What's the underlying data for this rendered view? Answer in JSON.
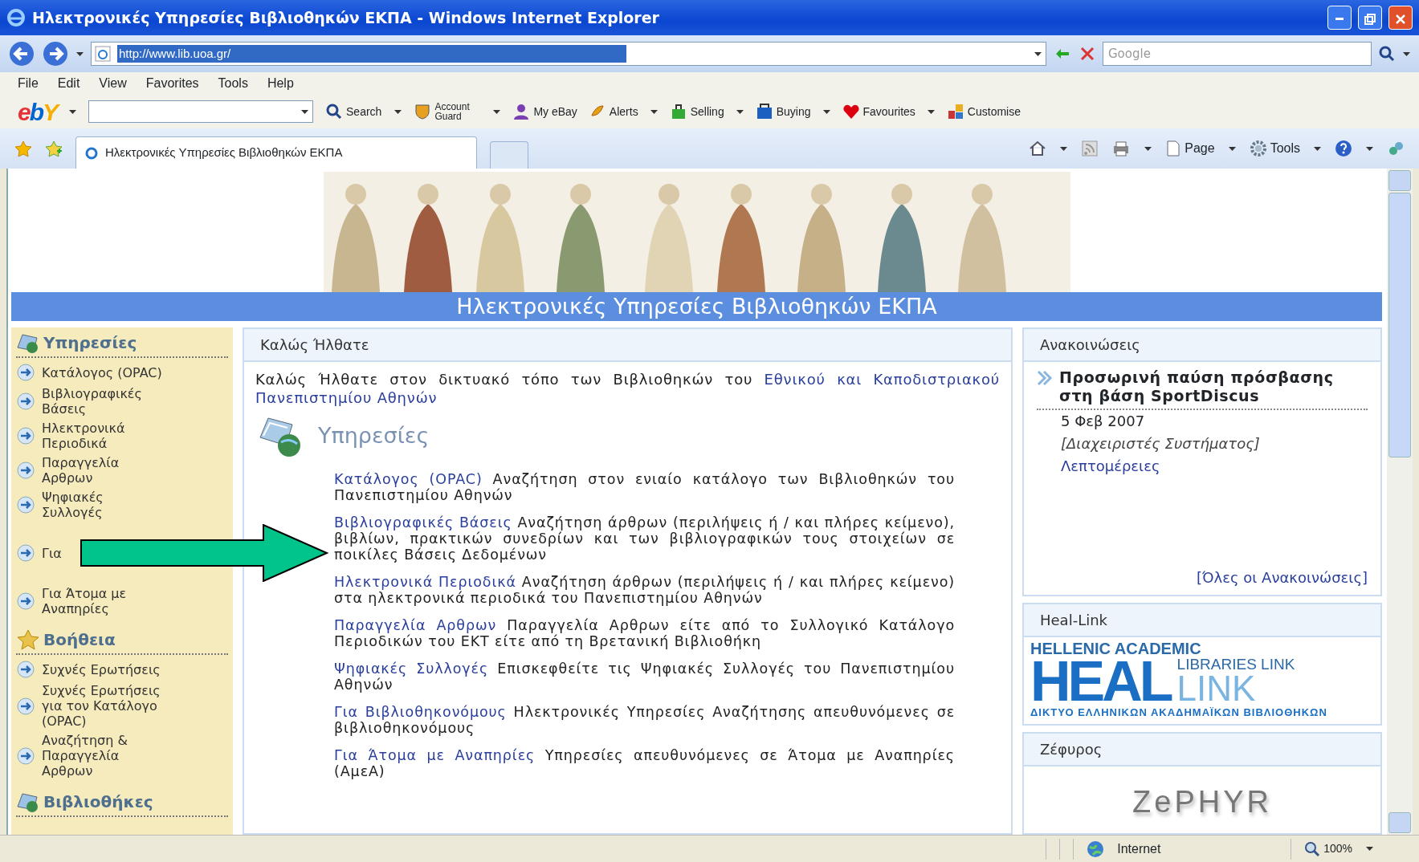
{
  "window": {
    "title": "Ηλεκτρονικές Υπηρεσίες Βιβλιοθηκών ΕΚΠΑ - Windows Internet Explorer"
  },
  "address_bar": {
    "url": "http://www.lib.uoa.gr/",
    "search_placeholder": "Google"
  },
  "menu": [
    "File",
    "Edit",
    "View",
    "Favorites",
    "Tools",
    "Help"
  ],
  "ebay_toolbar": {
    "logo": "ebY",
    "search_label": "Search",
    "items": [
      "Account Guard",
      "My eBay",
      "Alerts",
      "Selling",
      "Buying",
      "Favourites",
      "Customise"
    ]
  },
  "tab": {
    "title": "Ηλεκτρονικές Υπηρεσίες Βιβλιοθηκών ΕΚΠΑ",
    "selected": true
  },
  "command_bar": [
    "Page",
    "Tools"
  ],
  "page": {
    "banner_title": "Ηλεκτρονικές Υπηρεσίες Βιβλιοθηκών ΕΚΠΑ",
    "sidebar": [
      {
        "title": "Υπηρεσίες",
        "kind": "folder",
        "items": [
          "Κατάλογος (OPAC)",
          "Βιβλιογραφικές Βάσεις",
          "Ηλεκτρονικά Περιοδικά",
          "Παραγγελία Αρθρων",
          "Ψηφιακές Συλλογές",
          "Για",
          "Για Άτομα με Αναπηρίες"
        ]
      },
      {
        "title": "Βοήθεια",
        "kind": "star",
        "items": [
          "Συχνές Ερωτήσεις",
          "Συχνές Ερωτήσεις για τον Κατάλογο (OPAC)",
          "Αναζήτηση & Παραγγελία Αρθρων"
        ]
      },
      {
        "title": "Βιβλιοθήκες",
        "kind": "folder"
      }
    ],
    "welcome": {
      "header": "Καλώς Ήλθατε",
      "intro_text": "Καλώς Ήλθατε στον δικτυακό τόπο των Βιβλιοθηκών του",
      "intro_link": "Εθνικού και Καποδιστριακού Πανεπιστημίου Αθηνών",
      "services_title": "Υπηρεσίες",
      "services": [
        {
          "title": "Κατάλογος (OPAC)",
          "description": "Αναζήτηση στον ενιαίο κατάλογο των Βιβλιοθηκών του Πανεπιστημίου Αθηνών"
        },
        {
          "title": "Βιβλιογραφικές Βάσεις",
          "description": "Αναζήτηση άρθρων (περιλήψεις ή / και πλήρες κείμενο), βιβλίων, πρακτικών συνεδρίων και των βιβλιογραφικών τους στοιχείων σε ποικίλες Βάσεις Δεδομένων"
        },
        {
          "title": "Ηλεκτρονικά Περιοδικά",
          "description": "Αναζήτηση άρθρων (περιλήψεις ή / και πλήρες κείμενο) στα ηλεκτρονικά περιοδικά του Πανεπιστημίου Αθηνών"
        },
        {
          "title": "Παραγγελία Αρθρων",
          "description": "Παραγγελία Αρθρων είτε από το Συλλογικό Κατάλογο Περιοδικών του ΕΚΤ είτε από τη Βρετανική Βιβλιοθήκη"
        },
        {
          "title": "Ψηφιακές Συλλογές",
          "description": "Επισκεφθείτε τις Ψηφιακές Συλλογές του Πανεπιστημίου Αθηνών"
        },
        {
          "title": "Για Βιβλιοθηκονόμους",
          "description": "Ηλεκτρονικές Υπηρεσίες Αναζήτησης απευθυνόμενες σε βιβλιοθηκονόμους"
        },
        {
          "title": "Για Άτομα με Αναπηρίες",
          "description": "Υπηρεσίες απευθυνόμενες σε Άτομα με Αναπηρίες (ΑμεΑ)"
        }
      ]
    },
    "announcements": {
      "header": "Ανακοινώσεις",
      "items": [
        {
          "title": "Προσωρινή παύση πρόσβασης στη βάση SportDiscus",
          "date": "5 Φεβ 2007",
          "author": "[Διαχειριστές Συστήματος]",
          "more": "Λεπτομέρειες"
        }
      ],
      "all_link": "[Όλες οι Ανακοινώσεις]"
    },
    "heal_link": {
      "header": "Heal-Link",
      "logo_top": "HELLENIC ACADEMIC",
      "logo_main": "HEAL",
      "logo_right": "LIBRARIES LINK",
      "logo_link": "LINK",
      "logo_bottom": "ΔΙΚΤΥΟ ΕΛΛΗΝΙΚΩΝ ΑΚΑΔΗΜΑΪΚΩΝ ΒΙΒΛΙΟΘΗΚΩΝ"
    },
    "zephyr": {
      "header": "Ζέφυρος",
      "logo": "ZePHYR"
    }
  },
  "status_bar": {
    "zone": "Internet",
    "zoom": "100%"
  }
}
